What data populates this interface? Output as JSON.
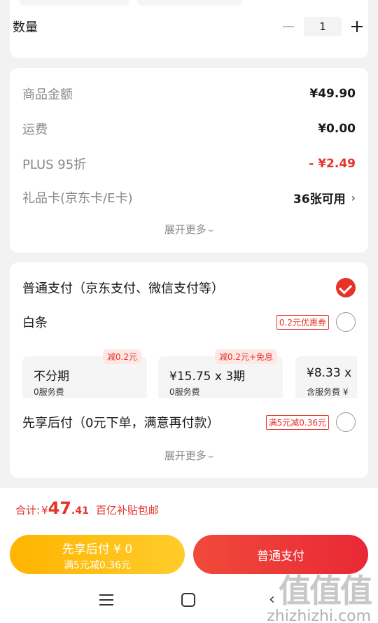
{
  "quantity": {
    "label": "数量",
    "value": "1"
  },
  "summary": {
    "rows": [
      {
        "label": "商品金额",
        "value": "¥49.90"
      },
      {
        "label": "运费",
        "value": "¥0.00"
      },
      {
        "label": "PLUS 95折",
        "value": "- ¥2.49"
      },
      {
        "label": "礼品卡(京东卡/E卡)",
        "value": "36张可用"
      }
    ],
    "expand_label": "展开更多"
  },
  "payment": {
    "normal": {
      "label": "普通支付（京东支付、微信支付等）",
      "selected": true
    },
    "baitiao": {
      "label": "白条",
      "coupon": "0.2元优惠券"
    },
    "plans": [
      {
        "main": "不分期",
        "sub": "0服务费",
        "tag": "减0.2元"
      },
      {
        "main": "¥15.75 x 3期",
        "sub": "0服务费",
        "tag": "减0.2元+免息"
      },
      {
        "main": "¥8.33 x",
        "sub": "含服务费 ¥",
        "tag": ""
      }
    ],
    "later": {
      "label": "先享后付（0元下单，满意再付款）",
      "coupon": "满5元减0.36元"
    },
    "expand_label": "展开更多"
  },
  "total": {
    "label": "合计:",
    "currency": "¥",
    "integer": "47",
    "decimal": ".41",
    "subsidy": "百亿补贴包邮"
  },
  "buttons": {
    "later_main": "先享后付 ¥ 0",
    "later_sub": "满5元减0.36元",
    "normal": "普通支付"
  },
  "watermark": {
    "logo": "值值值",
    "text": "zhizhizhi.com"
  },
  "colors": {
    "accent": "#e5332a",
    "yellow": "#ffb400"
  }
}
